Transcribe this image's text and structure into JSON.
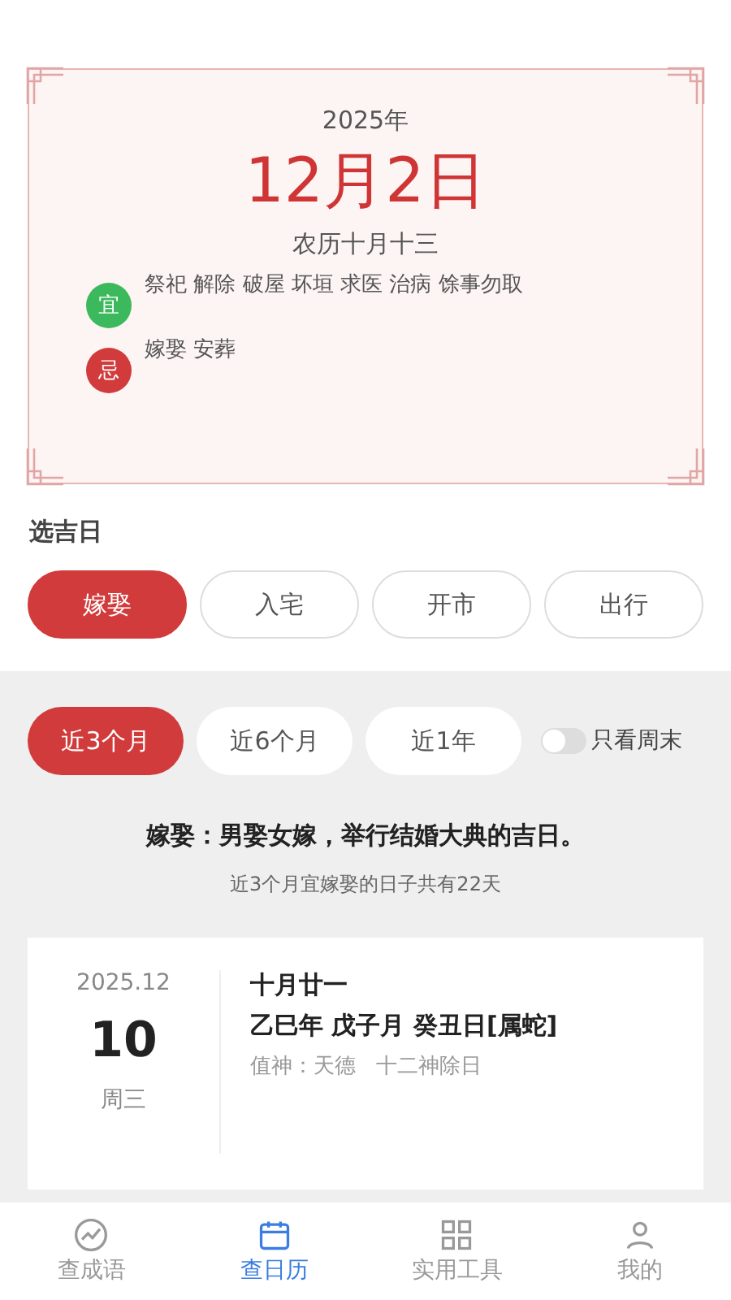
{
  "almanac": {
    "year": "2025年",
    "date": "12月2日",
    "lunar": "农历十月十三",
    "entries": [
      {
        "kind": "yi",
        "badge": "宜",
        "text": "祭祀 解除 破屋 坏垣 求医 治病 馀事勿取"
      },
      {
        "kind": "ji",
        "badge": "忌",
        "text": "嫁娶 安葬"
      }
    ]
  },
  "picker": {
    "title": "选吉日",
    "events": [
      {
        "label": "嫁娶",
        "selected": true
      },
      {
        "label": "入宅",
        "selected": false
      },
      {
        "label": "开市",
        "selected": false
      },
      {
        "label": "出行",
        "selected": false
      }
    ],
    "ranges": [
      {
        "label": "近3个月",
        "selected": true
      },
      {
        "label": "近6个月",
        "selected": false
      },
      {
        "label": "近1年",
        "selected": false
      }
    ],
    "weekend_toggle": {
      "label": "只看周末",
      "on": false
    },
    "description": "嫁娶：男娶女嫁，举行结婚大典的吉日。",
    "summary": "近3个月宜嫁娶的日子共有22天"
  },
  "results": [
    {
      "month": "2025.12",
      "day": "10",
      "weekday": "周三",
      "lunar": "十月廿一",
      "ganzhi": "乙巳年 戊子月 癸丑日[属蛇]",
      "gods": "值神：天德   十二神除日"
    }
  ],
  "nav": [
    {
      "label": "查成语",
      "kind": "chart",
      "selected": false
    },
    {
      "label": "查日历",
      "kind": "calendar",
      "selected": true
    },
    {
      "label": "实用工具",
      "kind": "tools",
      "selected": false
    },
    {
      "label": "我的",
      "kind": "user",
      "selected": false
    }
  ]
}
